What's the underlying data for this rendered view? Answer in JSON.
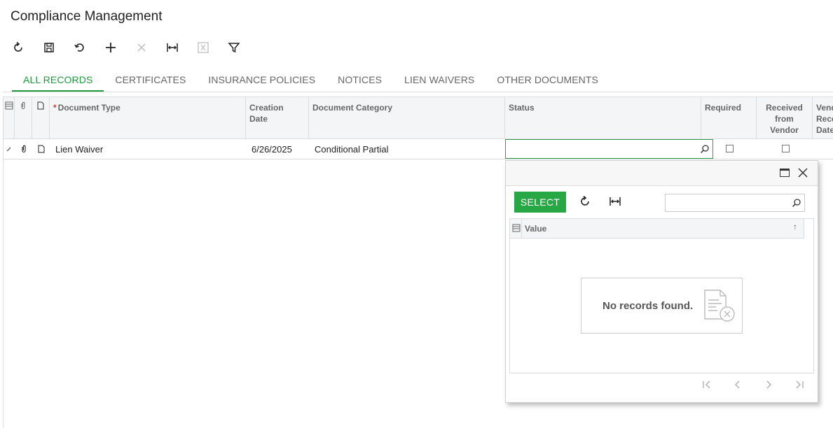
{
  "page": {
    "title": "Compliance Management"
  },
  "toolbar": {
    "buttons": [
      {
        "name": "refresh",
        "icon": "refresh-icon",
        "enabled": true
      },
      {
        "name": "save",
        "icon": "save-icon",
        "enabled": true
      },
      {
        "name": "undo",
        "icon": "undo-icon",
        "enabled": true
      },
      {
        "name": "add",
        "icon": "plus-icon",
        "enabled": true
      },
      {
        "name": "delete",
        "icon": "close-icon",
        "enabled": false
      },
      {
        "name": "fit-to-screen",
        "icon": "fit-width-icon",
        "enabled": true
      },
      {
        "name": "export",
        "icon": "excel-icon",
        "enabled": false
      },
      {
        "name": "filter",
        "icon": "filter-icon",
        "enabled": true
      }
    ]
  },
  "tabs": [
    {
      "label": "ALL RECORDS",
      "active": true
    },
    {
      "label": "CERTIFICATES",
      "active": false
    },
    {
      "label": "INSURANCE POLICIES",
      "active": false
    },
    {
      "label": "NOTICES",
      "active": false
    },
    {
      "label": "LIEN WAIVERS",
      "active": false
    },
    {
      "label": "OTHER DOCUMENTS",
      "active": false
    }
  ],
  "grid": {
    "columns": {
      "document_type": "Document Type",
      "creation_date_1": "Creation",
      "creation_date_2": "Date",
      "document_category": "Document Category",
      "status": "Status",
      "required": "Required",
      "received_1": "Received",
      "received_2": "from",
      "received_3": "Vendor",
      "vendor_1": "Vend",
      "vendor_2": "Rece",
      "vendor_3": "Date"
    },
    "rows": [
      {
        "document_type": "Lien Waiver",
        "creation_date": "6/26/2025",
        "document_category": "Conditional Partial",
        "status": "",
        "required": false,
        "received_from_vendor": false
      }
    ]
  },
  "lookup": {
    "select_label": "SELECT",
    "search_value": "",
    "column_value": "Value",
    "sort_indicator": "↑",
    "empty_message": "No records found."
  },
  "colors": {
    "accent": "#1f9a3c",
    "select_button": "#28a745",
    "required_marker": "#d9342b"
  }
}
